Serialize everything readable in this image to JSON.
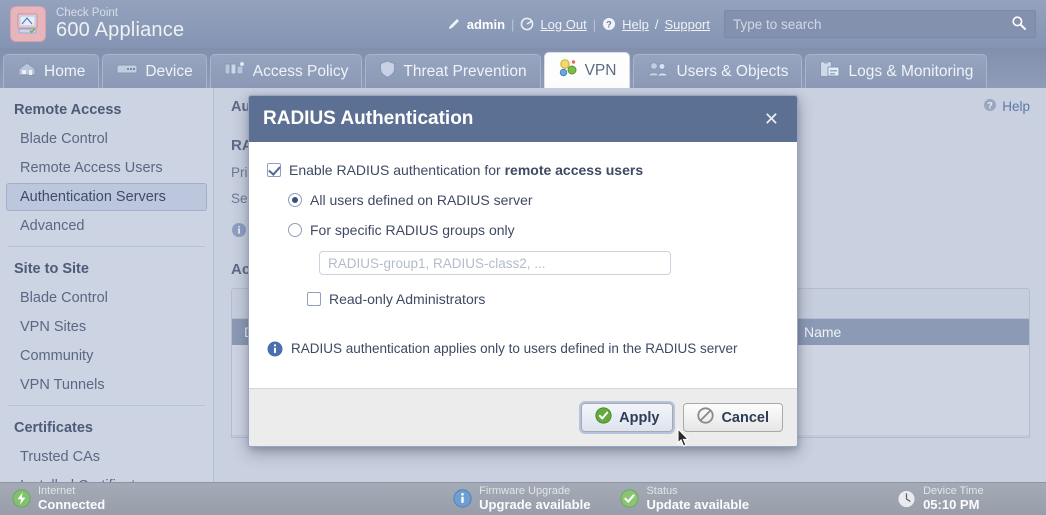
{
  "header": {
    "logo_icon": "appliance-logo-icon",
    "brand_line1": "Check Point",
    "brand_line2": "600 Appliance",
    "pencil_icon": "pencil-icon",
    "admin_label": "admin",
    "sep1": "|",
    "logout_icon": "power-icon",
    "logout_label": "Log Out",
    "sep2": "|",
    "help_icon": "question-icon",
    "help_label": "Help",
    "slash": "/",
    "support_label": "Support",
    "search_placeholder": "Type to search",
    "search_value": "",
    "search_icon": "search-icon"
  },
  "tabs": [
    {
      "label": "Home",
      "icon": "home-icon",
      "active": false
    },
    {
      "label": "Device",
      "icon": "device-icon",
      "active": false
    },
    {
      "label": "Access Policy",
      "icon": "access-policy-icon",
      "active": false
    },
    {
      "label": "Threat Prevention",
      "icon": "shield-icon",
      "active": false
    },
    {
      "label": "VPN",
      "icon": "vpn-icon",
      "active": true
    },
    {
      "label": "Users & Objects",
      "icon": "users-icon",
      "active": false
    },
    {
      "label": "Logs & Monitoring",
      "icon": "logs-icon",
      "active": false
    }
  ],
  "sidebar": {
    "groups": [
      {
        "title": "Remote Access",
        "items": [
          {
            "label": "Blade Control",
            "active": false
          },
          {
            "label": "Remote Access Users",
            "active": false
          },
          {
            "label": "Authentication Servers",
            "active": true
          },
          {
            "label": "Advanced",
            "active": false
          }
        ]
      },
      {
        "title": "Site to Site",
        "items": [
          {
            "label": "Blade Control",
            "active": false
          },
          {
            "label": "VPN Sites",
            "active": false
          },
          {
            "label": "Community",
            "active": false
          },
          {
            "label": "VPN Tunnels",
            "active": false
          }
        ]
      },
      {
        "title": "Certificates",
        "items": [
          {
            "label": "Trusted CAs",
            "active": false
          },
          {
            "label": "Installed Certificates",
            "active": false
          }
        ]
      }
    ]
  },
  "main": {
    "page_title": "Authentication Servers Definition",
    "help_label": "Help",
    "help_icon": "question-icon",
    "section_radius": "RADIUS",
    "field_primary": "Primary",
    "field_secondary": "Secondary",
    "note_icon": "info-icon",
    "note_text": "",
    "section_accounts": "Active Directory",
    "table_columns": [
      "Domain",
      "Name"
    ]
  },
  "modal": {
    "title": "RADIUS Authentication",
    "close_icon": "close-icon",
    "enable_checkbox": {
      "checked": true,
      "label_prefix": "Enable RADIUS authentication for ",
      "label_bold": "remote access users"
    },
    "radio_all": {
      "label": "All users defined on RADIUS server",
      "selected": true
    },
    "radio_specific": {
      "label": "For specific RADIUS groups only",
      "selected": false
    },
    "groups_input": {
      "placeholder": "RADIUS-group1, RADIUS-class2, ...",
      "value": ""
    },
    "readonly_checkbox": {
      "checked": false,
      "label": "Read-only Administrators"
    },
    "info_icon": "info-icon",
    "info_text": "RADIUS authentication applies only to users defined in the RADIUS server",
    "apply_button": {
      "label": "Apply",
      "icon": "check-circle-icon"
    },
    "cancel_button": {
      "label": "Cancel",
      "icon": "ban-circle-icon"
    }
  },
  "statusbar": [
    {
      "icon": "bolt-green-icon",
      "title": "Internet",
      "value": "Connected"
    },
    {
      "icon": "info-blue-icon",
      "title": "Firmware Upgrade",
      "value": "Upgrade available"
    },
    {
      "icon": "check-green-icon",
      "title": "Status",
      "value": "Update available"
    },
    {
      "icon": "clock-icon",
      "title": "Device Time",
      "value": "05:10 PM"
    }
  ],
  "colors": {
    "header": "#8b9ab8",
    "modal_header": "#5c7093",
    "page_background": "#c9d0e0",
    "sidebar": "#ccd3e2",
    "accent_green": "#6fb04a",
    "accent_blue": "#4a77b8"
  }
}
